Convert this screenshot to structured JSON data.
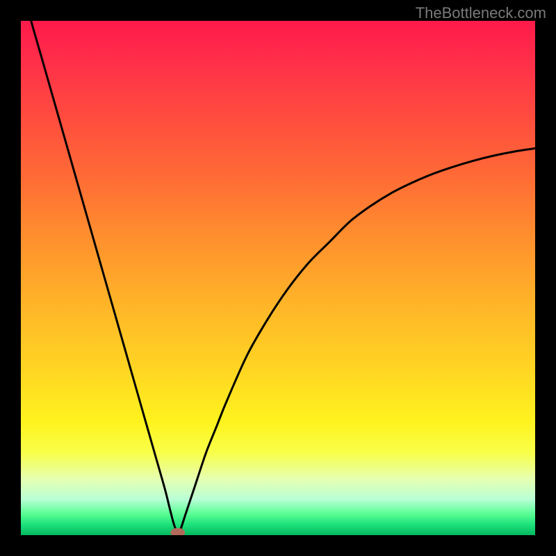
{
  "watermark": "TheBottleneck.com",
  "chart_data": {
    "type": "line",
    "title": "",
    "xlabel": "",
    "ylabel": "",
    "xlim": [
      0,
      100
    ],
    "ylim": [
      0,
      100
    ],
    "grid": false,
    "series": [
      {
        "name": "bottleneck-curve",
        "color": "#000000",
        "x": [
          0,
          2,
          4,
          6,
          8,
          10,
          12,
          14,
          16,
          18,
          20,
          22,
          24,
          26,
          28,
          29,
          29.8,
          30.5,
          31,
          32,
          33,
          34,
          36,
          38,
          40,
          44,
          48,
          52,
          56,
          60,
          64,
          68,
          72,
          76,
          80,
          84,
          88,
          92,
          96,
          100
        ],
        "y": [
          108,
          100,
          93,
          86,
          79,
          72,
          65,
          58,
          51,
          44,
          37,
          30,
          23,
          16,
          9,
          5,
          2,
          0.5,
          1,
          4,
          7,
          10,
          16,
          21,
          26,
          35,
          42,
          48,
          53,
          57,
          61,
          64,
          66.5,
          68.5,
          70.2,
          71.6,
          72.8,
          73.8,
          74.6,
          75.2
        ]
      }
    ],
    "marker": {
      "name": "optimum-point",
      "x": 30.5,
      "y": 0.5,
      "color": "#b26a5a",
      "rx": 1.4,
      "ry": 0.9
    },
    "background": {
      "type": "vertical-gradient",
      "stops": [
        {
          "pos": 0,
          "color": "#ff1a4a"
        },
        {
          "pos": 18,
          "color": "#ff4a3f"
        },
        {
          "pos": 42,
          "color": "#ff8f2e"
        },
        {
          "pos": 68,
          "color": "#ffd622"
        },
        {
          "pos": 84,
          "color": "#f8ff4a"
        },
        {
          "pos": 93,
          "color": "#baffd6"
        },
        {
          "pos": 100,
          "color": "#05b860"
        }
      ]
    }
  }
}
